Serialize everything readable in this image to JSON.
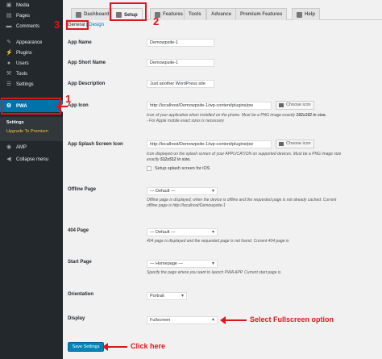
{
  "sidebar": {
    "items": [
      {
        "label": "Media",
        "icon": "media-icon"
      },
      {
        "label": "Pages",
        "icon": "pages-icon"
      },
      {
        "label": "Comments",
        "icon": "comments-icon"
      },
      {
        "label": "Appearance",
        "icon": "appearance-icon"
      },
      {
        "label": "Plugins",
        "icon": "plugins-icon"
      },
      {
        "label": "Users",
        "icon": "users-icon"
      },
      {
        "label": "Tools",
        "icon": "tools-icon"
      },
      {
        "label": "Settings",
        "icon": "settings-icon"
      },
      {
        "label": "PWA",
        "icon": "gear-icon"
      },
      {
        "label": "AMP",
        "icon": "amp-icon"
      },
      {
        "label": "Collapse menu",
        "icon": "collapse-icon"
      }
    ],
    "submenu": {
      "settings": "Settings",
      "upgrade": "Upgrade To Premium"
    }
  },
  "tabs": [
    {
      "label": "Dashboard"
    },
    {
      "label": "Setup"
    },
    {
      "label": "Features"
    },
    {
      "label": "Tools"
    },
    {
      "label": "Advance"
    },
    {
      "label": "Premium Features"
    },
    {
      "label": "Help"
    }
  ],
  "subnav": {
    "general": "General",
    "separator": "|",
    "design": "Design"
  },
  "annotations": {
    "n1": "1",
    "n2": "2",
    "n3": "3",
    "fullscreen": "Select Fullscreen option",
    "click": "Click here"
  },
  "form": {
    "app_name": {
      "label": "App Name",
      "value": "Demowpsite-1"
    },
    "app_short_name": {
      "label": "App Short Name",
      "value": "Demowpsite-1"
    },
    "app_description": {
      "label": "App Description",
      "value": "Just another WordPress site"
    },
    "app_icon": {
      "label": "App Icon",
      "value": "http://localhost/Demowpsite-1/wp-content/plugins/pw",
      "button": "Choose icon",
      "desc1": "Icon of your application when installed on the phone. Must be a PNG image exactly ",
      "desc1_bold": "192x192 in size.",
      "desc2": "- For Apple mobile exact sizes is necessary"
    },
    "splash": {
      "label": "App Splash Screen Icon",
      "value": "http://localhost/Demowpsite-1/wp-content/plugins/pw",
      "button": "Choose icon",
      "desc1": "Icon displayed on the splash screen of your APPLICATION on supported devices. Must be a PNG image size",
      "desc2": "exactly ",
      "desc2_bold": "512x512 in size.",
      "checkbox_label": "Setup splash screen for iOS"
    },
    "offline": {
      "label": "Offline Page",
      "value": "— Default —",
      "desc1": "Offline page is displayed, when the device is offline and the requested page is not already cached. Current",
      "desc2": "offline page is http://localhost/Demowpsite-1"
    },
    "page404": {
      "label": "404 Page",
      "value": "— Default —",
      "desc": "404 page is displayed and the requested page is not found. Current 404 page is"
    },
    "start": {
      "label": "Start Page",
      "value": "— Homepage —",
      "desc": "Specify the page where you want to launch PWA APP. Current start page is"
    },
    "orientation": {
      "label": "Orientation",
      "value": "Portrait"
    },
    "display": {
      "label": "Display",
      "value": "Fullscreen"
    }
  },
  "save_label": "Save Settings",
  "colors": {
    "annotation_red": "#e0151b",
    "wp_blue": "#0073aa",
    "sidebar_dark": "#23282d"
  }
}
